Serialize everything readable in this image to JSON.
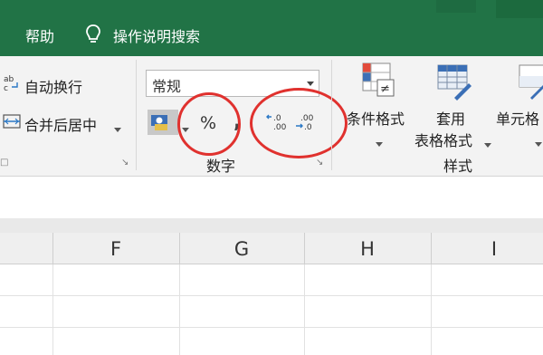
{
  "title_bar": {
    "help_label": "帮助",
    "tell_me_label": "操作说明搜索"
  },
  "alignment_group": {
    "wrap_text_label": "自动换行",
    "merge_center_label": "合并后居中",
    "wrap_icon_text": "ab c"
  },
  "number_group": {
    "format_value": "常规",
    "percent_label": "%",
    "comma_label": ",",
    "increase_decimal_label": ".0 .00",
    "decrease_decimal_label": ".00 .0",
    "group_label": "数字"
  },
  "styles_group": {
    "conditional_format_label": "条件格式",
    "table_format_label_1": "套用",
    "table_format_label_2": "表格格式",
    "cell_styles_label": "单元格",
    "group_label": "样式"
  },
  "columns": [
    "F",
    "G",
    "H",
    "I"
  ],
  "colors": {
    "ribbon_green": "#217346",
    "annotation_red": "#e0312e"
  }
}
